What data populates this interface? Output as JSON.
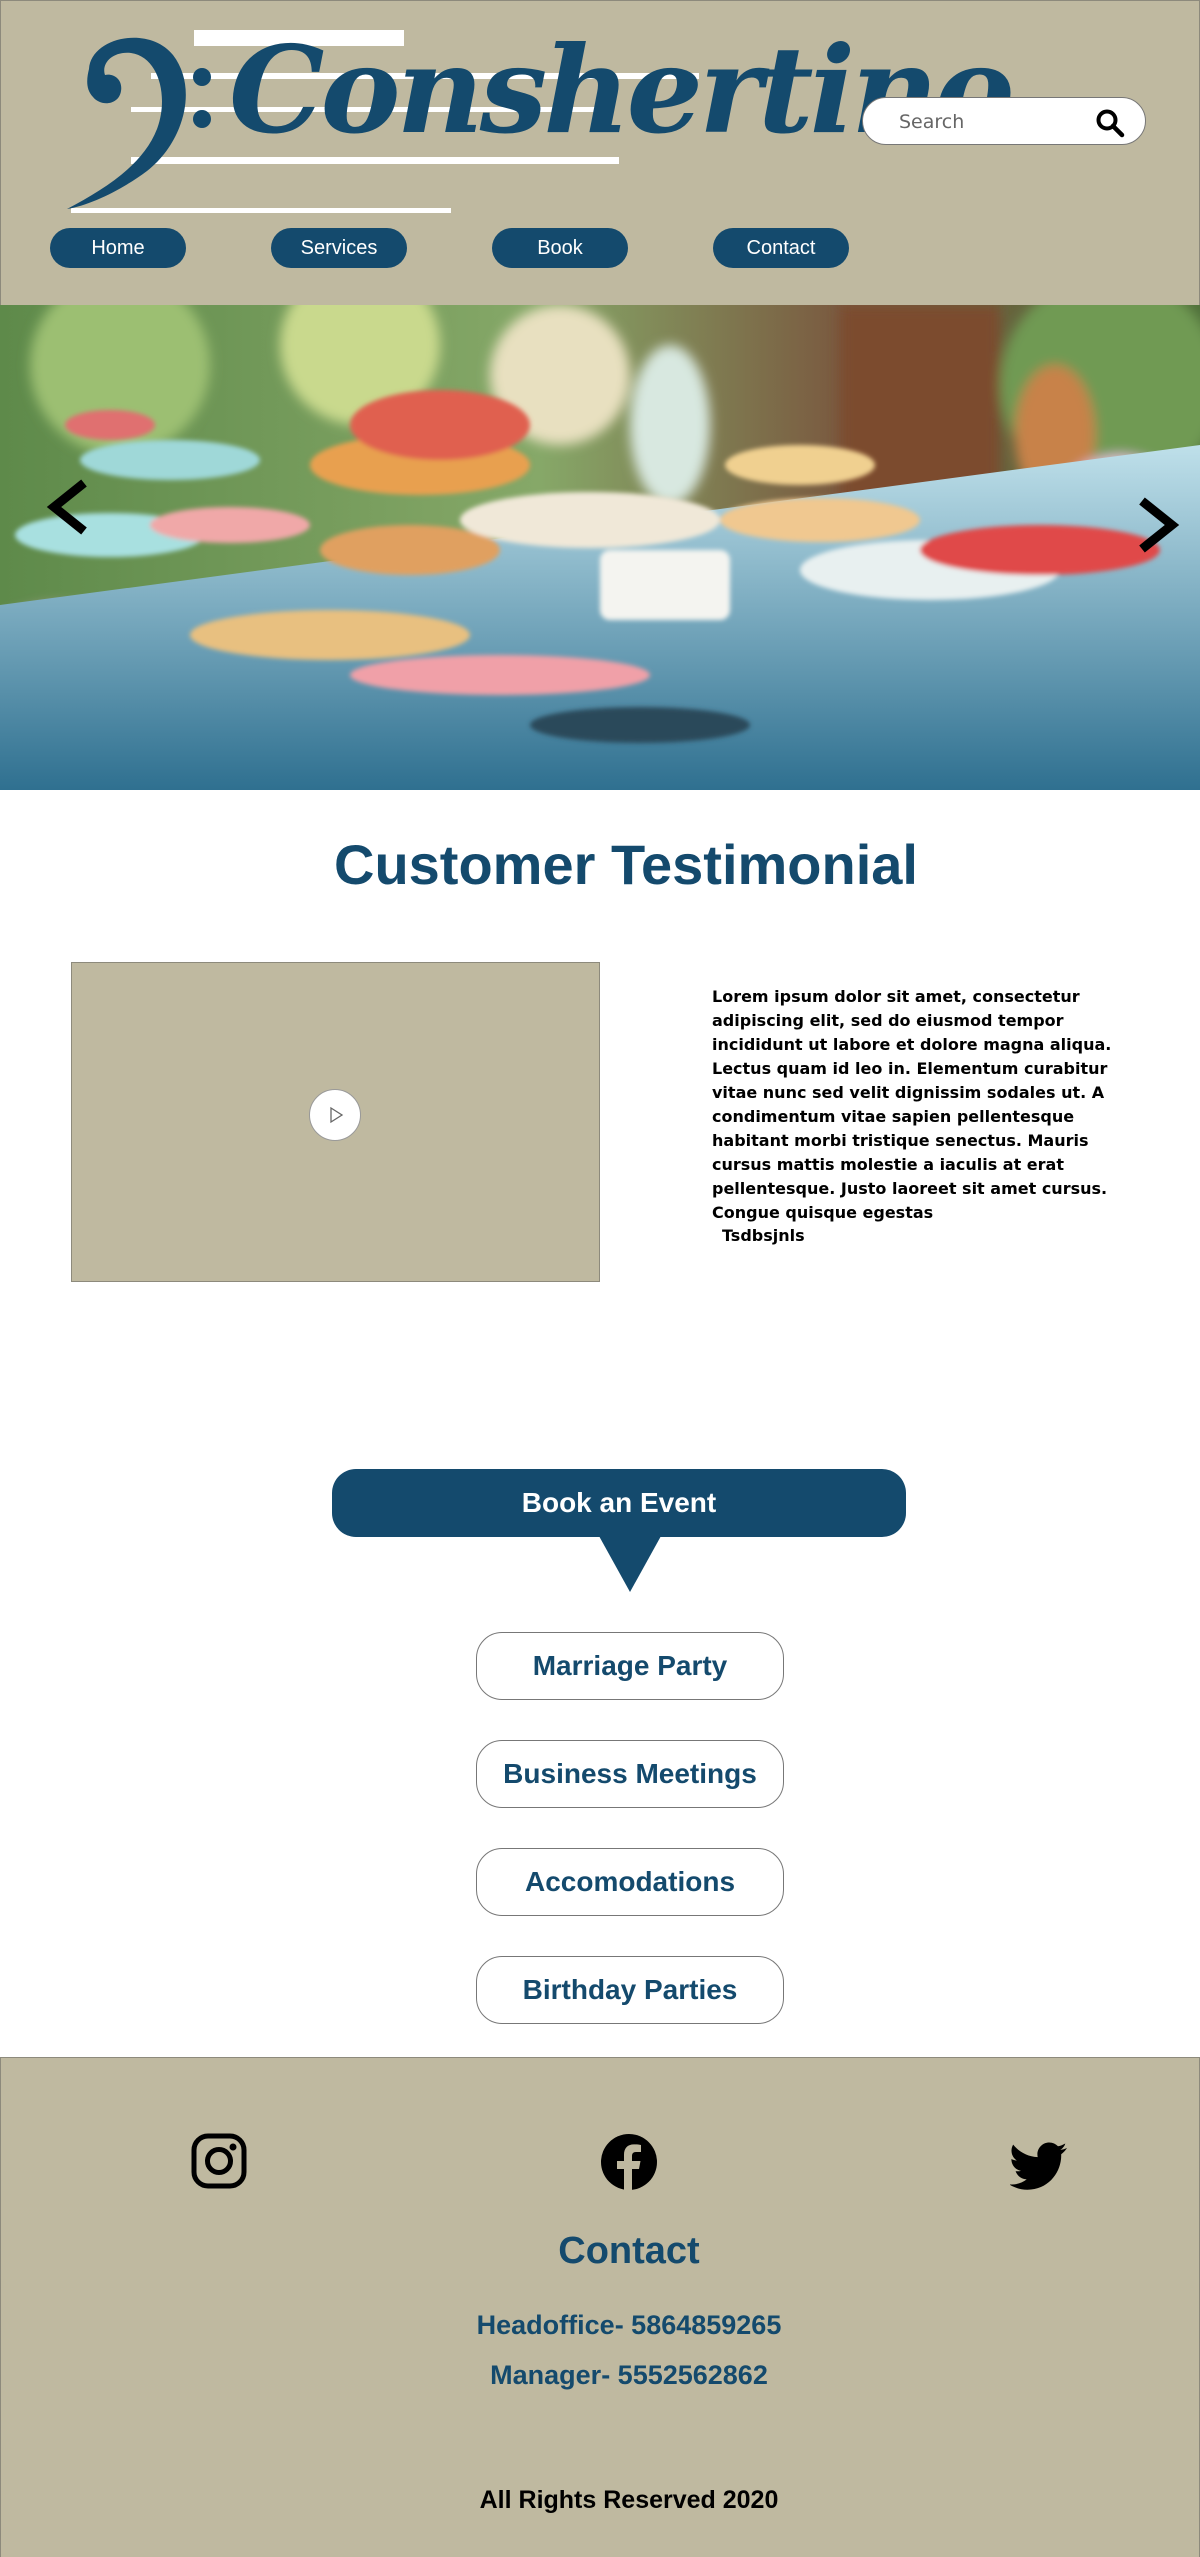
{
  "header": {
    "logo_text": "Conshertino",
    "search": {
      "placeholder": "Search",
      "value": ""
    },
    "nav": [
      {
        "label": "Home"
      },
      {
        "label": "Services"
      },
      {
        "label": "Book"
      },
      {
        "label": "Contact"
      }
    ]
  },
  "hero": {
    "image": "party-buffet-table",
    "prev_icon": "chevron-left-icon",
    "next_icon": "chevron-right-icon"
  },
  "testimonial": {
    "title": "Customer Testimonial",
    "video_icon": "play-icon",
    "text": "Lorem ipsum dolor sit amet, consectetur adipiscing elit, sed do eiusmod tempor incididunt ut labore et dolore magna aliqua. Lectus quam id leo in. Elementum curabitur vitae nunc sed velit dignissim sodales ut. A condimentum vitae sapien pellentesque habitant morbi tristique senectus. Mauris cursus mattis molestie a iaculis at erat pellentesque. Justo laoreet sit amet cursus. Congue quisque egestas",
    "author": "Tsdbsjnls"
  },
  "booking": {
    "button_label": "Book an Event",
    "events": [
      {
        "label": "Marriage Party"
      },
      {
        "label": "Business Meetings"
      },
      {
        "label": "Accomodations"
      },
      {
        "label": "Birthday Parties"
      }
    ]
  },
  "footer": {
    "social": [
      "instagram-icon",
      "facebook-icon",
      "twitter-icon"
    ],
    "contact_title": "Contact",
    "headoffice": "Headoffice- 5864859265",
    "manager": "Manager- 5552562862",
    "copyright": "All Rights Reserved 2020"
  },
  "colors": {
    "primary": "#144a6d",
    "header_bg": "#bfb9a0",
    "footer_bg": "#bfb9a0",
    "surface": "#ffffff"
  }
}
